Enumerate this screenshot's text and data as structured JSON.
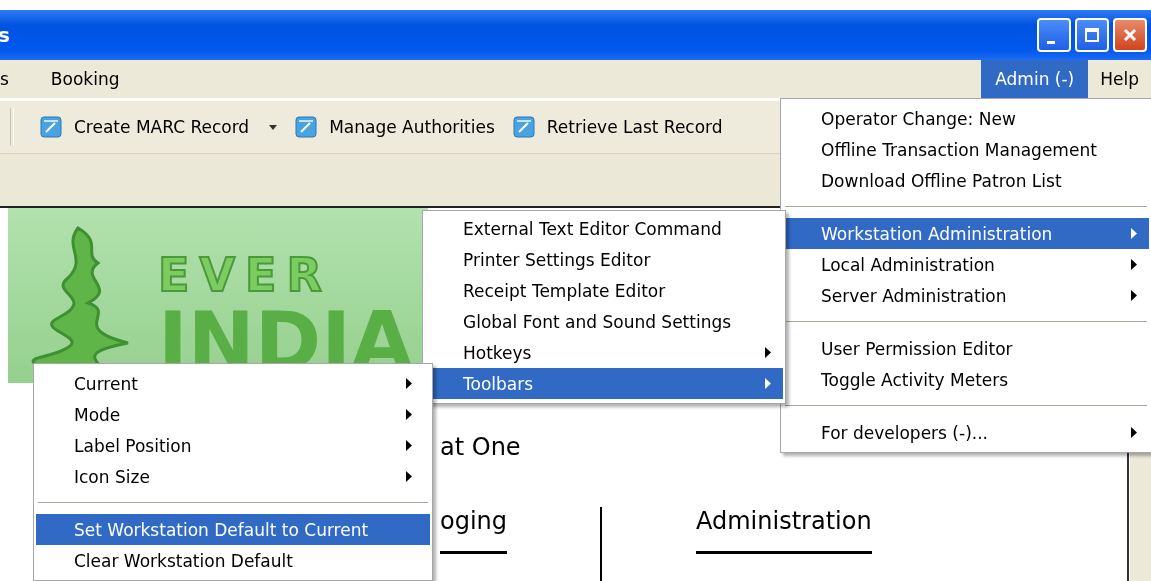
{
  "window": {
    "title": "s"
  },
  "menubar": {
    "left": [
      {
        "label": "s",
        "selected": false
      },
      {
        "label": "Booking",
        "selected": false
      }
    ],
    "right": [
      {
        "label": "Admin (-)",
        "selected": true
      },
      {
        "label": "Help",
        "selected": false
      }
    ]
  },
  "toolbar": [
    {
      "label": "Create MARC Record",
      "dropdown": true
    },
    {
      "label": "Manage Authorities",
      "dropdown": false
    },
    {
      "label": "Retrieve Last Record",
      "dropdown": false
    }
  ],
  "logo": {
    "line_1": "EVER",
    "line_2": "INDIA"
  },
  "content": {
    "heading": "at One",
    "columns": [
      "oging",
      "Administration"
    ]
  },
  "admin_menu": [
    {
      "kind": "item",
      "label": "Operator Change: New",
      "selected": false,
      "submenu": false
    },
    {
      "kind": "item",
      "label": "Offline Transaction Management",
      "selected": false,
      "submenu": false
    },
    {
      "kind": "item",
      "label": "Download Offline Patron List",
      "selected": false,
      "submenu": false
    },
    {
      "kind": "separator"
    },
    {
      "kind": "item",
      "label": "Workstation Administration",
      "selected": true,
      "submenu": true
    },
    {
      "kind": "item",
      "label": "Local Administration",
      "selected": false,
      "submenu": true
    },
    {
      "kind": "item",
      "label": "Server Administration",
      "selected": false,
      "submenu": true
    },
    {
      "kind": "separator"
    },
    {
      "kind": "item",
      "label": "User Permission Editor",
      "selected": false,
      "submenu": false
    },
    {
      "kind": "item",
      "label": "Toggle Activity Meters",
      "selected": false,
      "submenu": false
    },
    {
      "kind": "separator"
    },
    {
      "kind": "item",
      "label": "For developers (-)...",
      "selected": false,
      "submenu": true
    }
  ],
  "workstation_menu": [
    {
      "kind": "item",
      "label": "External Text Editor Command",
      "selected": false,
      "submenu": false
    },
    {
      "kind": "item",
      "label": "Printer Settings Editor",
      "selected": false,
      "submenu": false
    },
    {
      "kind": "item",
      "label": "Receipt Template Editor",
      "selected": false,
      "submenu": false
    },
    {
      "kind": "item",
      "label": "Global Font and Sound Settings",
      "selected": false,
      "submenu": false
    },
    {
      "kind": "item",
      "label": "Hotkeys",
      "selected": false,
      "submenu": true
    },
    {
      "kind": "item",
      "label": "Toolbars",
      "selected": true,
      "submenu": true
    }
  ],
  "toolbars_menu": [
    {
      "kind": "item",
      "label": "Current",
      "selected": false,
      "submenu": true
    },
    {
      "kind": "item",
      "label": "Mode",
      "selected": false,
      "submenu": true
    },
    {
      "kind": "item",
      "label": "Label Position",
      "selected": false,
      "submenu": true
    },
    {
      "kind": "item",
      "label": "Icon Size",
      "selected": false,
      "submenu": true
    },
    {
      "kind": "separator"
    },
    {
      "kind": "item",
      "label": "Set Workstation Default to Current",
      "selected": true,
      "submenu": false
    },
    {
      "kind": "item",
      "label": "Clear Workstation Default",
      "selected": false,
      "submenu": false
    }
  ]
}
